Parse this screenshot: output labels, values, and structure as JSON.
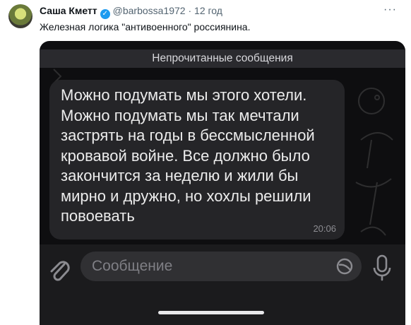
{
  "tweet": {
    "author_name": "Саша Кметт",
    "handle": "@barbossa1972",
    "separator": "·",
    "time": "12 год",
    "more": "···",
    "text": "Железная логика \"антивоенного\" россиянина."
  },
  "screenshot": {
    "unread_label": "Непрочитанные сообщения",
    "message_text": "Можно подумать мы этого хотели. Можно подумать мы так мечтали застрять на годы в бессмысленной кровавой войне. Все должно было закончится за неделю и жили бы мирно и дружно, но хохлы решили повоевать",
    "message_time": "20:06",
    "input_placeholder": "Сообщение"
  },
  "icons": {
    "verified": "verified-badge-icon",
    "attach": "paperclip-icon",
    "sticker": "sticker-icon",
    "mic": "microphone-icon"
  },
  "colors": {
    "verified_blue": "#1d9bf0",
    "chat_background": "#0e0e10",
    "bubble": "#252528"
  }
}
